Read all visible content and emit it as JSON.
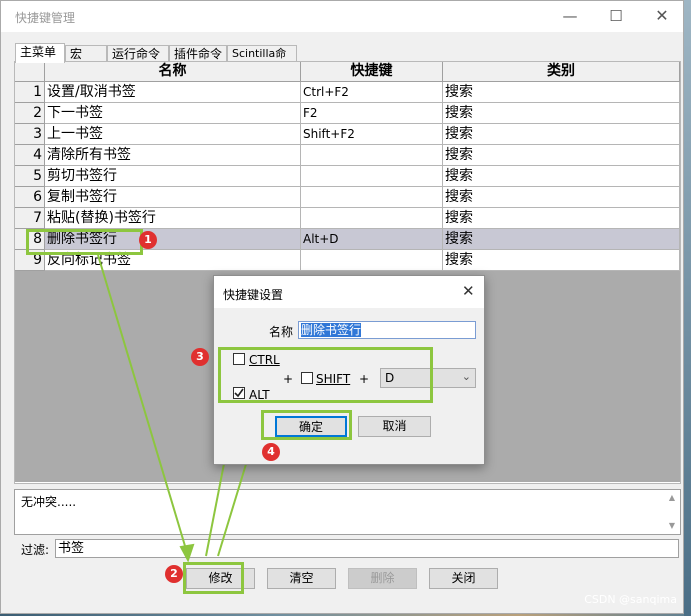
{
  "window": {
    "title": "快捷键管理"
  },
  "tabs": [
    {
      "label": "主菜单"
    },
    {
      "label": "宏"
    },
    {
      "label": "运行命令"
    },
    {
      "label": "插件命令"
    },
    {
      "label": "Scintilla命令"
    }
  ],
  "table": {
    "columns": [
      "名称",
      "快捷键",
      "类别"
    ],
    "rows": [
      {
        "n": "1",
        "name": "设置/取消书签",
        "key": "Ctrl+F2",
        "cat": "搜索"
      },
      {
        "n": "2",
        "name": "下一书签",
        "key": "F2",
        "cat": "搜索"
      },
      {
        "n": "3",
        "name": "上一书签",
        "key": "Shift+F2",
        "cat": "搜索"
      },
      {
        "n": "4",
        "name": "清除所有书签",
        "key": "",
        "cat": "搜索"
      },
      {
        "n": "5",
        "name": "剪切书签行",
        "key": "",
        "cat": "搜索"
      },
      {
        "n": "6",
        "name": "复制书签行",
        "key": "",
        "cat": "搜索"
      },
      {
        "n": "7",
        "name": "粘贴(替换)书签行",
        "key": "",
        "cat": "搜索"
      },
      {
        "n": "8",
        "name": "删除书签行",
        "key": "Alt+D",
        "cat": "搜索"
      },
      {
        "n": "9",
        "name": "反向标记书签",
        "key": "",
        "cat": "搜索"
      }
    ]
  },
  "status": {
    "text": "无冲突....."
  },
  "filter": {
    "label": "过滤:",
    "value": "书签"
  },
  "buttons": {
    "modify": "修改",
    "clear": "清空",
    "delete": "删除",
    "close": "关闭"
  },
  "dialog": {
    "title": "快捷键设置",
    "name_label": "名称",
    "name_value": "删除书签行",
    "ctrl": "CTRL",
    "shift": "SHIFT",
    "alt": "ALT",
    "plus1": "+",
    "plus2": "+",
    "key_value": "D",
    "ok": "确定",
    "cancel": "取消"
  },
  "annotations": [
    "1",
    "2",
    "3",
    "4"
  ],
  "credit": "CSDN @sanqima",
  "colors": {
    "highlight": "#8dc63f",
    "marker": "#e0302f",
    "selected_row": "#c8c8d4"
  }
}
